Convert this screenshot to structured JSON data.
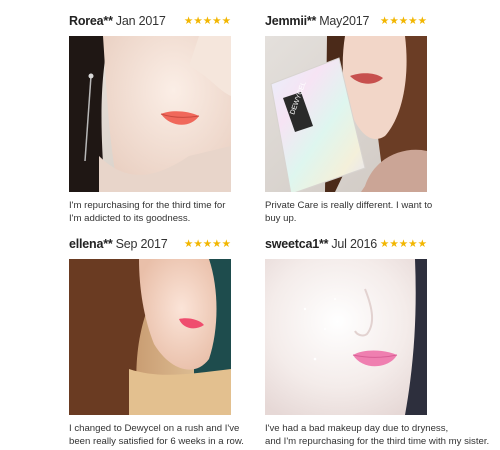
{
  "reviews": [
    {
      "user": "Rorea**",
      "date": "Jan 2017",
      "rating": 5,
      "caption": [
        "I'm repurchasing for the third time for",
        "I'm addicted to its goodness."
      ],
      "photo": "woman-face-coral-lip"
    },
    {
      "user": "Jemmii**",
      "date": "May2017",
      "rating": 5,
      "caption": [
        "Private Care is really different. I want to",
        "buy up."
      ],
      "photo": "woman-with-dewycel-box",
      "product_box_label": "DEWYCEL"
    },
    {
      "user": "ellena**",
      "date": "Sep 2017",
      "rating": 5,
      "caption": [
        "I changed to Dewycel on a rush and I've",
        "been really satisfied for 6 weeks in a row."
      ],
      "photo": "woman-profile-pink-lip"
    },
    {
      "user": "sweetca1**",
      "date": "Jul 2016",
      "rating": 5,
      "caption": [
        "I've had a bad makeup day due to dryness,",
        "and I'm repurchasing for the third time with my sister."
      ],
      "photo": "woman-face-glossy-skin"
    }
  ],
  "colors": {
    "star": "#f2b600",
    "text": "#2b2b2b"
  }
}
